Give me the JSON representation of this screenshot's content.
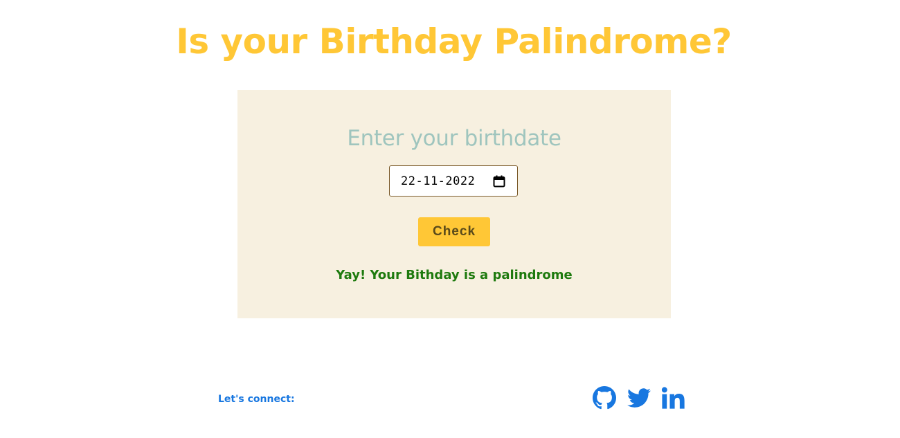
{
  "header": {
    "title": "Is your Birthday Palindrome?"
  },
  "form": {
    "heading": "Enter your birthdate",
    "date_value": "22-11-2022",
    "check_label": "Check",
    "result": "Yay! Your Bithday is a palindrome"
  },
  "footer": {
    "connect_label": "Let's connect:",
    "social_icons": [
      "github-icon",
      "twitter-icon",
      "linkedin-icon"
    ]
  },
  "colors": {
    "title": "#ffc736",
    "card_background": "#f7f0e0",
    "heading": "#9fc5be",
    "button": "#ffc736",
    "result": "#1e7a0e",
    "link": "#1877e0"
  }
}
